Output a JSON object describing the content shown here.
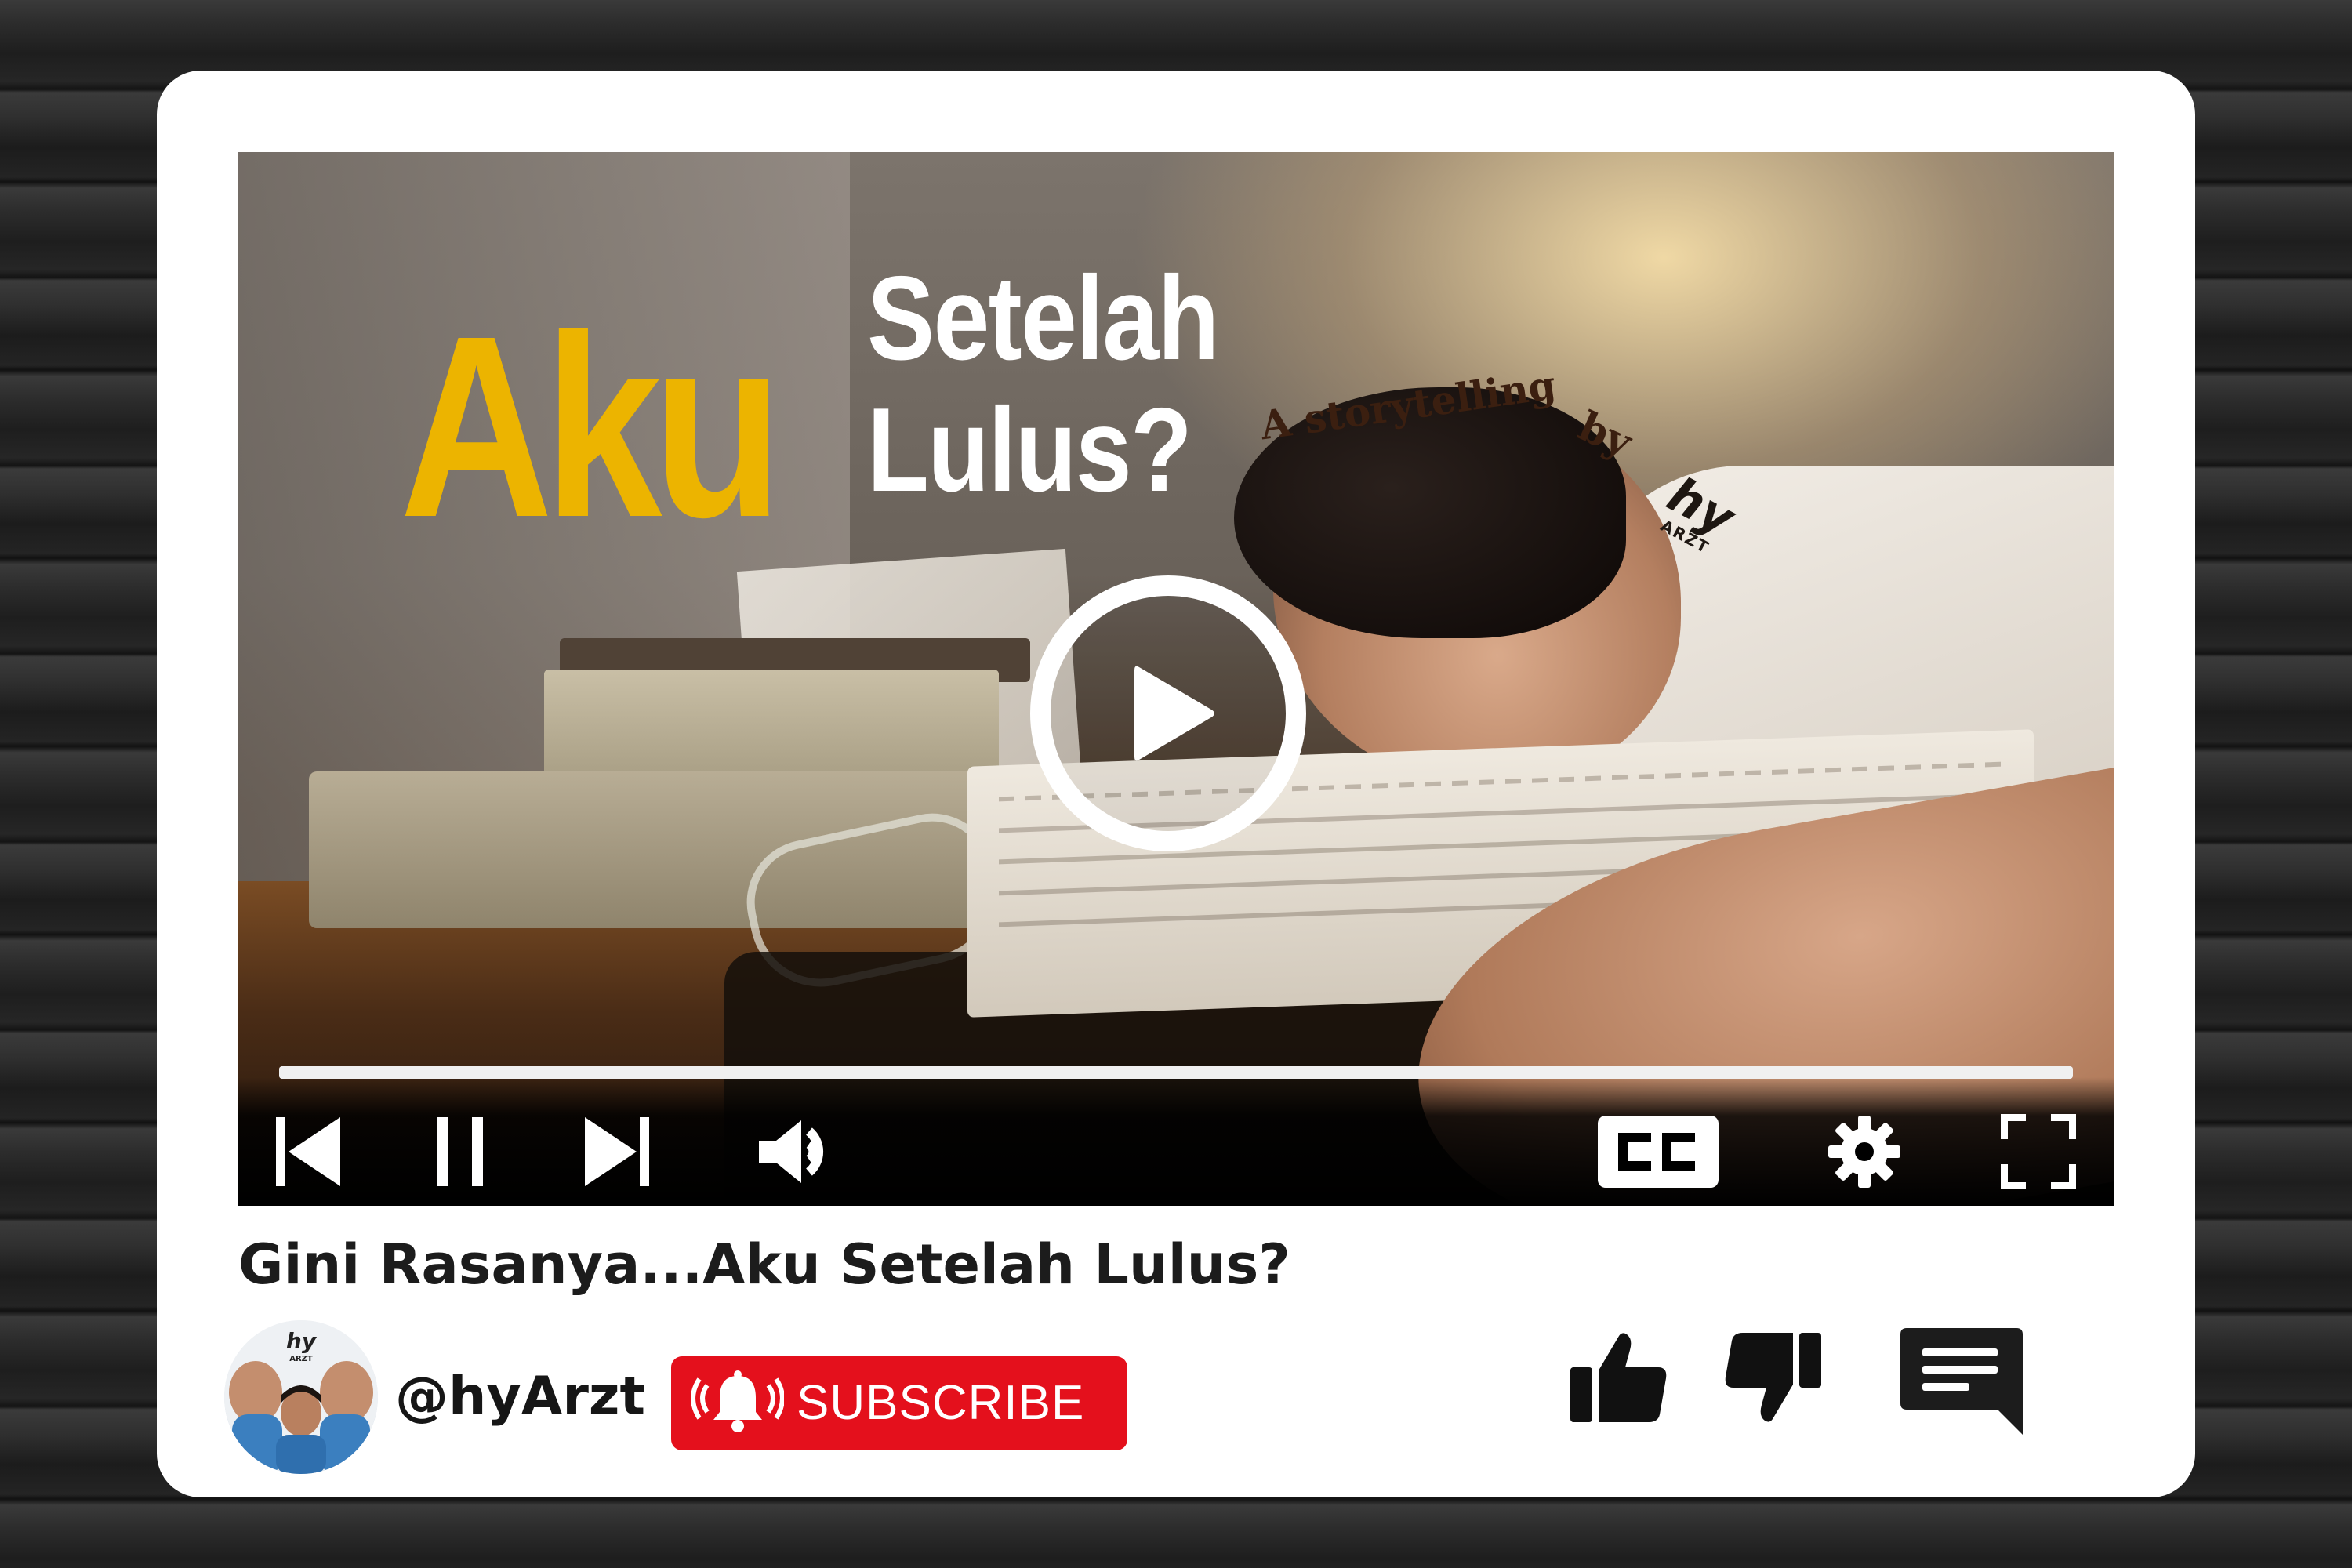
{
  "thumbnail": {
    "title_big": "Aku",
    "title_sub_line1": "Setelah",
    "title_sub_line2": "Lulus?",
    "tagline": "A storytelling",
    "tagline_by": "by",
    "logo_text": "hy",
    "logo_sub": "ARZT"
  },
  "video": {
    "title": "Gini Rasanya...Aku Setelah Lulus?",
    "progress": 1.0
  },
  "channel": {
    "handle": "@hyArzt",
    "avatar_logo": "hy",
    "avatar_logo_sub": "ARZT"
  },
  "subscribe": {
    "label": "SUBSCRIBE",
    "icon": "bell-icon"
  },
  "controls": {
    "prev": "skip-previous-icon",
    "pause": "pause-icon",
    "next": "skip-next-icon",
    "volume": "volume-icon",
    "captions": "closed-captions-icon",
    "settings": "gear-icon",
    "fullscreen": "fullscreen-icon"
  },
  "actions": {
    "like": "thumbs-up-icon",
    "dislike": "thumbs-down-icon",
    "comment": "comment-icon"
  },
  "colors": {
    "title_yellow": "#ecb400",
    "subscribe_red": "#e4101c",
    "card_bg": "#ffffff"
  }
}
